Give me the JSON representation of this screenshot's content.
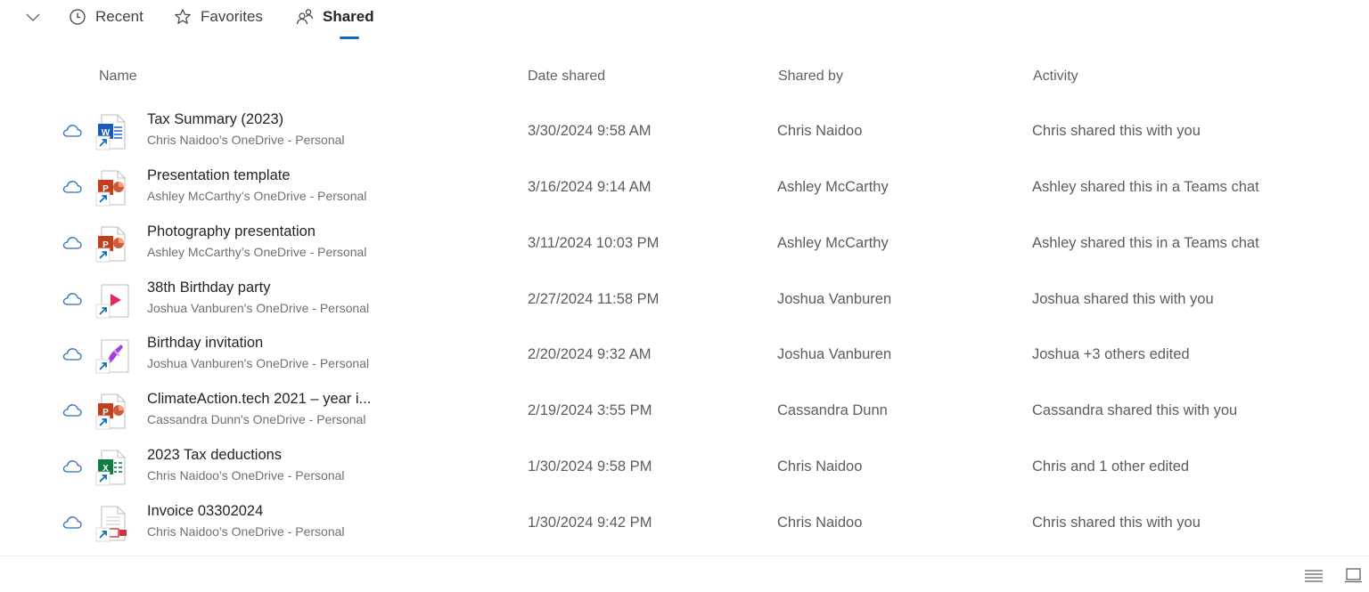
{
  "tabs": {
    "collapse_icon": "chevron-down-icon",
    "items": [
      {
        "label": "Recent",
        "icon": "clock-icon",
        "active": false
      },
      {
        "label": "Favorites",
        "icon": "star-icon",
        "active": false
      },
      {
        "label": "Shared",
        "icon": "people-icon",
        "active": true
      }
    ],
    "accent": "#0f6cbd"
  },
  "columns": [
    "Name",
    "Date shared",
    "Shared by",
    "Activity"
  ],
  "files": [
    {
      "name": "Tax Summary (2023)",
      "location": "Chris Naidoo’s OneDrive - Personal",
      "type": "word",
      "date": "3/30/2024 9:58 AM",
      "shared_by": "Chris Naidoo",
      "activity": "Chris shared this with you"
    },
    {
      "name": "Presentation template",
      "location": "Ashley McCarthy’s OneDrive - Personal",
      "type": "powerpoint",
      "date": "3/16/2024 9:14 AM",
      "shared_by": "Ashley McCarthy",
      "activity": "Ashley shared this in a Teams chat"
    },
    {
      "name": "Photography presentation",
      "location": "Ashley McCarthy’s OneDrive - Personal",
      "type": "powerpoint",
      "date": "3/11/2024 10:03 PM",
      "shared_by": "Ashley McCarthy",
      "activity": "Ashley shared this in a Teams chat"
    },
    {
      "name": "38th Birthday party",
      "location": "Joshua Vanburen's OneDrive - Personal",
      "type": "video",
      "date": "2/27/2024 11:58 PM",
      "shared_by": "Joshua Vanburen",
      "activity": "Joshua shared this with you"
    },
    {
      "name": "Birthday invitation",
      "location": "Joshua Vanburen's OneDrive - Personal",
      "type": "designer",
      "date": "2/20/2024 9:32 AM",
      "shared_by": "Joshua Vanburen",
      "activity": "Joshua +3 others edited"
    },
    {
      "name": "ClimateAction.tech 2021 – year i...",
      "location": "Cassandra Dunn's OneDrive - Personal",
      "type": "powerpoint",
      "date": "2/19/2024 3:55 PM",
      "shared_by": "Cassandra Dunn",
      "activity": "Cassandra shared this with you"
    },
    {
      "name": "2023 Tax deductions",
      "location": "Chris Naidoo’s OneDrive - Personal",
      "type": "excel",
      "date": "1/30/2024 9:58 PM",
      "shared_by": "Chris Naidoo",
      "activity": "Chris and 1 other edited"
    },
    {
      "name": "Invoice 03302024",
      "location": "Chris Naidoo’s OneDrive - Personal",
      "type": "pdf",
      "date": "1/30/2024 9:42 PM",
      "shared_by": "Chris Naidoo",
      "activity": "Chris shared this with you"
    }
  ],
  "status_icon": "cloud-icon",
  "footer": {
    "views": [
      {
        "icon": "list-view-icon",
        "label": "List view"
      },
      {
        "icon": "tile-view-icon",
        "label": "Tile view"
      }
    ]
  },
  "colors": {
    "word": "#185abd",
    "powerpoint": "#c43e1c",
    "excel": "#107c41",
    "video": "#e3285b",
    "designer": "#a33ee0",
    "pdf": "#d13438",
    "shortcut": "#0f6cbd"
  }
}
